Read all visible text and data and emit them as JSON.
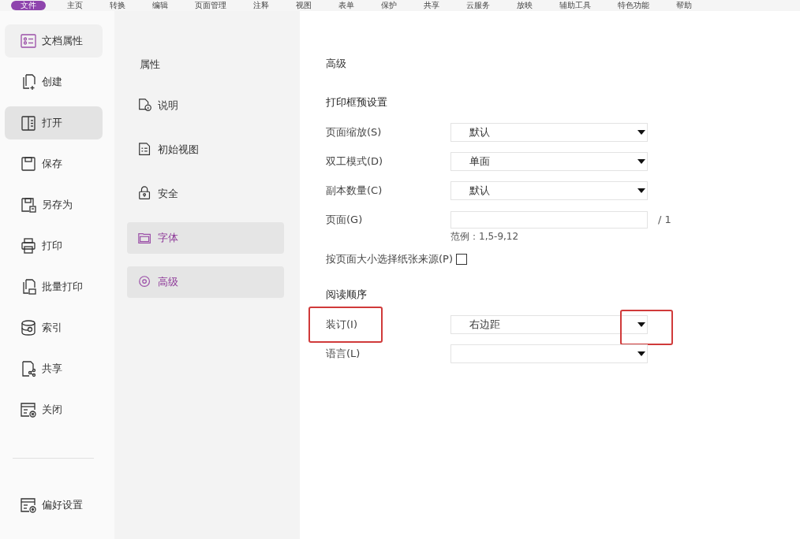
{
  "menu_bar": [
    {
      "label": "文件",
      "selected": true
    },
    {
      "label": "主页",
      "selected": false
    },
    {
      "label": "转换",
      "selected": false
    },
    {
      "label": "编辑",
      "selected": false
    },
    {
      "label": "页面管理",
      "selected": false
    },
    {
      "label": "注释",
      "selected": false
    },
    {
      "label": "视图",
      "selected": false
    },
    {
      "label": "表单",
      "selected": false
    },
    {
      "label": "保护",
      "selected": false
    },
    {
      "label": "共享",
      "selected": false
    },
    {
      "label": "云服务",
      "selected": false
    },
    {
      "label": "放映",
      "selected": false
    },
    {
      "label": "辅助工具",
      "selected": false
    },
    {
      "label": "特色功能",
      "selected": false
    },
    {
      "label": "帮助",
      "selected": false
    }
  ],
  "sidebar": {
    "items": [
      {
        "label": "文档属性",
        "selected": true,
        "hovered": false
      },
      {
        "label": "创建",
        "selected": false,
        "hovered": false
      },
      {
        "label": "打开",
        "selected": false,
        "hovered": true
      },
      {
        "label": "保存",
        "selected": false,
        "hovered": false
      },
      {
        "label": "另存为",
        "selected": false,
        "hovered": false
      },
      {
        "label": "打印",
        "selected": false,
        "hovered": false
      },
      {
        "label": "批量打印",
        "selected": false,
        "hovered": false
      },
      {
        "label": "索引",
        "selected": false,
        "hovered": false
      },
      {
        "label": "共享",
        "selected": false,
        "hovered": false
      },
      {
        "label": "关闭",
        "selected": false,
        "hovered": false
      }
    ],
    "footer_items": [
      {
        "label": "偏好设置",
        "selected": false,
        "hovered": false
      }
    ]
  },
  "categories": {
    "title": "属性",
    "items": [
      {
        "label": "说明",
        "selected": false
      },
      {
        "label": "初始视图",
        "selected": false
      },
      {
        "label": "安全",
        "selected": false
      },
      {
        "label": "字体",
        "selected": true
      },
      {
        "label": "高级",
        "selected": true
      }
    ]
  },
  "panel": {
    "title": "高级",
    "sections": [
      {
        "heading": "打印框预设置",
        "rows": [
          {
            "kind": "select",
            "label": "页面缩放(S)",
            "value": "默认"
          },
          {
            "kind": "select",
            "label": "双工模式(D)",
            "value": "单面"
          },
          {
            "kind": "select",
            "label": "副本数量(C)",
            "value": "默认"
          },
          {
            "kind": "input",
            "label": "页面(G)",
            "suffix": "/ 1",
            "hint": "范例：1,5-9,12"
          },
          {
            "kind": "checkbox",
            "label": "按页面大小选择纸张来源(P)",
            "checked": false
          }
        ]
      },
      {
        "heading": "阅读顺序",
        "rows": [
          {
            "kind": "select",
            "label": "装订(I)",
            "value": "右边距",
            "highlight": true,
            "arrow_highlight": true
          },
          {
            "kind": "select",
            "label": "语言(L)"
          }
        ]
      }
    ]
  }
}
